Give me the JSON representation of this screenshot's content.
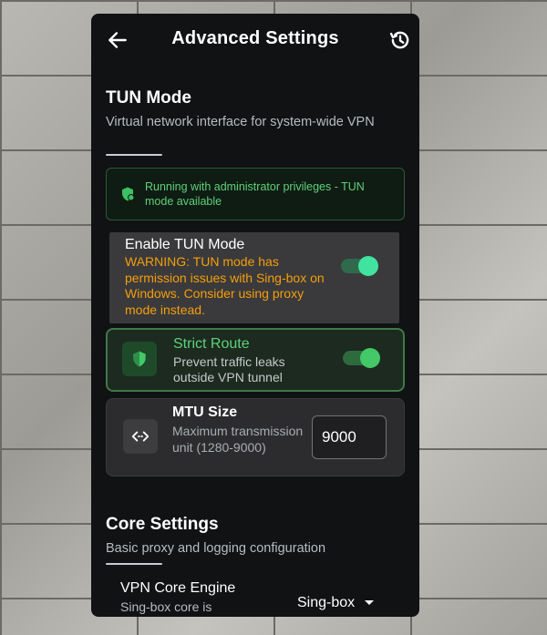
{
  "header": {
    "title": "Advanced Settings",
    "back_icon": "arrow-left-icon",
    "history_icon": "history-icon"
  },
  "tun_section": {
    "title": "TUN Mode",
    "subtitle": "Virtual network interface for system-wide VPN",
    "admin_notice": "Running with administrator privileges - TUN mode available",
    "enable": {
      "label": "Enable TUN Mode",
      "warning": "WARNING: TUN mode has permission issues with Sing-box on Windows. Consider using proxy mode instead.",
      "enabled": true
    },
    "strict_route": {
      "title": "Strict Route",
      "description": "Prevent traffic leaks outside VPN tunnel",
      "enabled": true
    },
    "mtu": {
      "title": "MTU Size",
      "description": "Maximum transmission unit (1280-9000)",
      "value": "9000"
    }
  },
  "core_section": {
    "title": "Core Settings",
    "subtitle": "Basic proxy and logging configuration",
    "engine": {
      "label": "VPN Core Engine",
      "sublabel": "Sing-box core is",
      "selected": "Sing-box"
    }
  },
  "colors": {
    "panel_bg": "#101214",
    "accent_green": "#5ed17a",
    "warning_orange": "#f59e0b",
    "toggle_knob": "#40e3a0"
  }
}
